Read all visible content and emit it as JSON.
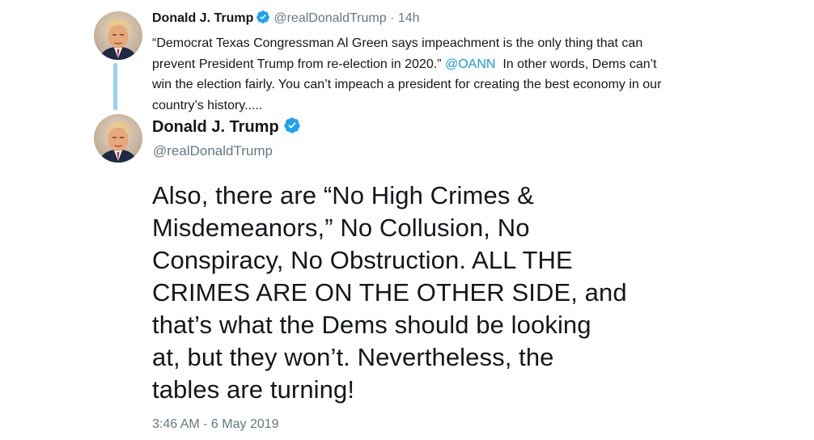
{
  "parent_tweet": {
    "display_name": "Donald J. Trump",
    "handle": "@realDonaldTrump",
    "separator": "·",
    "relative_time": "14h",
    "text_part1": "“Democrat Texas Congressman Al Green says impeachment is the only thing that can prevent President Trump from re-election in 2020.” ",
    "mention": "@OANN",
    "text_part2": "  In other words, Dems can’t win the election fairly. You can’t impeach a president for creating the best economy in our country’s history.....",
    "verified_icon": "verified-badge-icon",
    "avatar_icon": "profile-avatar"
  },
  "main_tweet": {
    "display_name": "Donald J. Trump",
    "handle": "@realDonaldTrump",
    "lines": [
      "Also, there are “No High Crimes &",
      "Misdemeanors,” No Collusion, No",
      "Conspiracy, No Obstruction. ALL THE",
      "CRIMES ARE ON THE OTHER SIDE, and",
      "that’s what the Dems should be looking",
      "at, but they won’t. Nevertheless, the",
      "tables are turning!"
    ],
    "timestamp": "3:46 AM - 6 May 2019",
    "verified_icon": "verified-badge-icon",
    "avatar_icon": "profile-avatar"
  },
  "colors": {
    "link": "#1b95e0",
    "muted": "#657786",
    "text": "#14171a",
    "thread_line": "#9ad0f5",
    "verified": "#1da1f2"
  }
}
